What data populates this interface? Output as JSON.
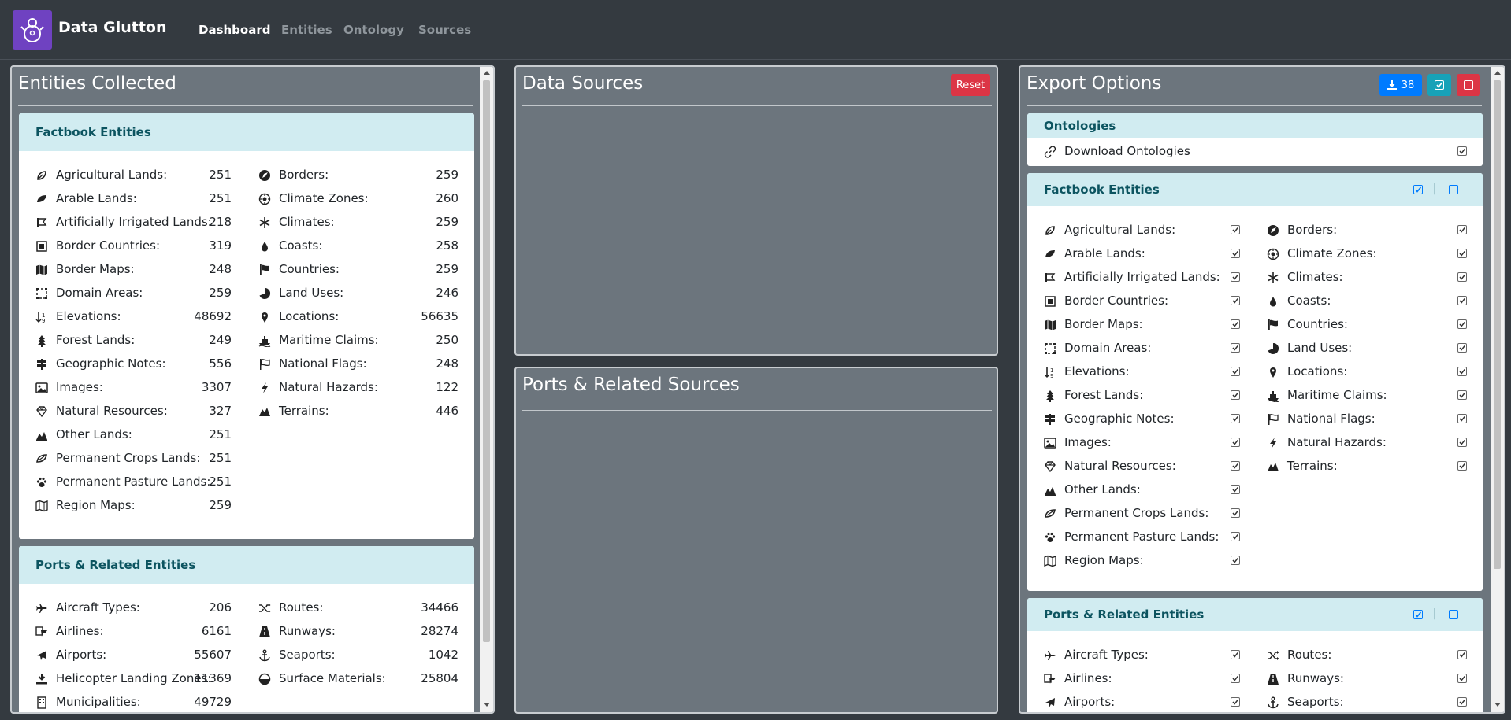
{
  "app": {
    "title": "Data Glutton",
    "nav": [
      {
        "label": "Dashboard",
        "active": true
      },
      {
        "label": "Entities",
        "active": false
      },
      {
        "label": "Ontology",
        "active": false
      },
      {
        "label": "Sources",
        "active": false
      }
    ]
  },
  "colors": {
    "brand": "#6f42c1",
    "panel": "#6c757d",
    "card_header": "#d1ecf1",
    "card_header_text": "#0c5460",
    "reset": "#dc3545",
    "download": "#007bff",
    "select_all": "#17a2b8",
    "clear": "#dc3545"
  },
  "entities_panel": {
    "title": "Entities Collected",
    "factbook": {
      "title": "Factbook Entities",
      "left": [
        {
          "icon": "agricultural-lands-icon",
          "label": "Agricultural Lands:",
          "value": "251"
        },
        {
          "icon": "arable-lands-icon",
          "label": "Arable Lands:",
          "value": "251"
        },
        {
          "icon": "irrigated-lands-icon",
          "label": "Artificially Irrigated Lands:",
          "value": "218"
        },
        {
          "icon": "border-countries-icon",
          "label": "Border Countries:",
          "value": "319"
        },
        {
          "icon": "border-maps-icon",
          "label": "Border Maps:",
          "value": "248"
        },
        {
          "icon": "domain-areas-icon",
          "label": "Domain Areas:",
          "value": "259"
        },
        {
          "icon": "elevations-icon",
          "label": "Elevations:",
          "value": "48692"
        },
        {
          "icon": "forest-lands-icon",
          "label": "Forest Lands:",
          "value": "249"
        },
        {
          "icon": "geographic-notes-icon",
          "label": "Geographic Notes:",
          "value": "556"
        },
        {
          "icon": "images-icon",
          "label": "Images:",
          "value": "3307"
        },
        {
          "icon": "natural-resources-icon",
          "label": "Natural Resources:",
          "value": "327"
        },
        {
          "icon": "other-lands-icon",
          "label": "Other Lands:",
          "value": "251"
        },
        {
          "icon": "permanent-crops-icon",
          "label": "Permanent Crops Lands:",
          "value": "251"
        },
        {
          "icon": "permanent-pasture-icon",
          "label": "Permanent Pasture Lands:",
          "value": "251"
        },
        {
          "icon": "region-maps-icon",
          "label": "Region Maps:",
          "value": "259"
        }
      ],
      "right": [
        {
          "icon": "borders-icon",
          "label": "Borders:",
          "value": "259"
        },
        {
          "icon": "climate-zones-icon",
          "label": "Climate Zones:",
          "value": "260"
        },
        {
          "icon": "climates-icon",
          "label": "Climates:",
          "value": "259"
        },
        {
          "icon": "coasts-icon",
          "label": "Coasts:",
          "value": "258"
        },
        {
          "icon": "countries-icon",
          "label": "Countries:",
          "value": "259"
        },
        {
          "icon": "land-uses-icon",
          "label": "Land Uses:",
          "value": "246"
        },
        {
          "icon": "locations-icon",
          "label": "Locations:",
          "value": "56635"
        },
        {
          "icon": "maritime-claims-icon",
          "label": "Maritime Claims:",
          "value": "250"
        },
        {
          "icon": "national-flags-icon",
          "label": "National Flags:",
          "value": "248"
        },
        {
          "icon": "natural-hazards-icon",
          "label": "Natural Hazards:",
          "value": "122"
        },
        {
          "icon": "terrains-icon",
          "label": "Terrains:",
          "value": "446"
        }
      ]
    },
    "ports": {
      "title": "Ports & Related Entities",
      "left": [
        {
          "icon": "aircraft-types-icon",
          "label": "Aircraft Types:",
          "value": "206"
        },
        {
          "icon": "airlines-icon",
          "label": "Airlines:",
          "value": "6161"
        },
        {
          "icon": "airports-icon",
          "label": "Airports:",
          "value": "55607"
        },
        {
          "icon": "helicopter-landing-icon",
          "label": "Helicopter Landing Zones:",
          "value": "11369"
        },
        {
          "icon": "municipalities-icon",
          "label": "Municipalities:",
          "value": "49729"
        }
      ],
      "right": [
        {
          "icon": "routes-icon",
          "label": "Routes:",
          "value": "34466"
        },
        {
          "icon": "runways-icon",
          "label": "Runways:",
          "value": "28274"
        },
        {
          "icon": "seaports-icon",
          "label": "Seaports:",
          "value": "1042"
        },
        {
          "icon": "surface-materials-icon",
          "label": "Surface Materials:",
          "value": "25804"
        }
      ]
    }
  },
  "data_sources": {
    "title": "Data Sources",
    "reset_label": "Reset"
  },
  "ports_sources": {
    "title": "Ports & Related Sources"
  },
  "export": {
    "title": "Export Options",
    "download_count": "38",
    "ontologies": {
      "title": "Ontologies",
      "items": [
        {
          "icon": "link-icon",
          "label": "Download Ontologies",
          "checked": true
        }
      ]
    },
    "factbook": {
      "title": "Factbook Entities",
      "separator": "|",
      "left": [
        {
          "icon": "agricultural-lands-icon",
          "label": "Agricultural Lands:",
          "checked": true
        },
        {
          "icon": "arable-lands-icon",
          "label": "Arable Lands:",
          "checked": true
        },
        {
          "icon": "irrigated-lands-icon",
          "label": "Artificially Irrigated Lands:",
          "checked": true
        },
        {
          "icon": "border-countries-icon",
          "label": "Border Countries:",
          "checked": true
        },
        {
          "icon": "border-maps-icon",
          "label": "Border Maps:",
          "checked": true
        },
        {
          "icon": "domain-areas-icon",
          "label": "Domain Areas:",
          "checked": true
        },
        {
          "icon": "elevations-icon",
          "label": "Elevations:",
          "checked": true
        },
        {
          "icon": "forest-lands-icon",
          "label": "Forest Lands:",
          "checked": true
        },
        {
          "icon": "geographic-notes-icon",
          "label": "Geographic Notes:",
          "checked": true
        },
        {
          "icon": "images-icon",
          "label": "Images:",
          "checked": true
        },
        {
          "icon": "natural-resources-icon",
          "label": "Natural Resources:",
          "checked": true
        },
        {
          "icon": "other-lands-icon",
          "label": "Other Lands:",
          "checked": true
        },
        {
          "icon": "permanent-crops-icon",
          "label": "Permanent Crops Lands:",
          "checked": true
        },
        {
          "icon": "permanent-pasture-icon",
          "label": "Permanent Pasture Lands:",
          "checked": true
        },
        {
          "icon": "region-maps-icon",
          "label": "Region Maps:",
          "checked": true
        }
      ],
      "right": [
        {
          "icon": "borders-icon",
          "label": "Borders:",
          "checked": true
        },
        {
          "icon": "climate-zones-icon",
          "label": "Climate Zones:",
          "checked": true
        },
        {
          "icon": "climates-icon",
          "label": "Climates:",
          "checked": true
        },
        {
          "icon": "coasts-icon",
          "label": "Coasts:",
          "checked": true
        },
        {
          "icon": "countries-icon",
          "label": "Countries:",
          "checked": true
        },
        {
          "icon": "land-uses-icon",
          "label": "Land Uses:",
          "checked": true
        },
        {
          "icon": "locations-icon",
          "label": "Locations:",
          "checked": true
        },
        {
          "icon": "maritime-claims-icon",
          "label": "Maritime Claims:",
          "checked": true
        },
        {
          "icon": "national-flags-icon",
          "label": "National Flags:",
          "checked": true
        },
        {
          "icon": "natural-hazards-icon",
          "label": "Natural Hazards:",
          "checked": true
        },
        {
          "icon": "terrains-icon",
          "label": "Terrains:",
          "checked": true
        }
      ]
    },
    "ports": {
      "title": "Ports & Related Entities",
      "separator": "|",
      "left": [
        {
          "icon": "aircraft-types-icon",
          "label": "Aircraft Types:",
          "checked": true
        },
        {
          "icon": "airlines-icon",
          "label": "Airlines:",
          "checked": true
        },
        {
          "icon": "airports-icon",
          "label": "Airports:",
          "checked": true
        }
      ],
      "right": [
        {
          "icon": "routes-icon",
          "label": "Routes:",
          "checked": true
        },
        {
          "icon": "runways-icon",
          "label": "Runways:",
          "checked": true
        },
        {
          "icon": "seaports-icon",
          "label": "Seaports:",
          "checked": true
        }
      ]
    }
  }
}
